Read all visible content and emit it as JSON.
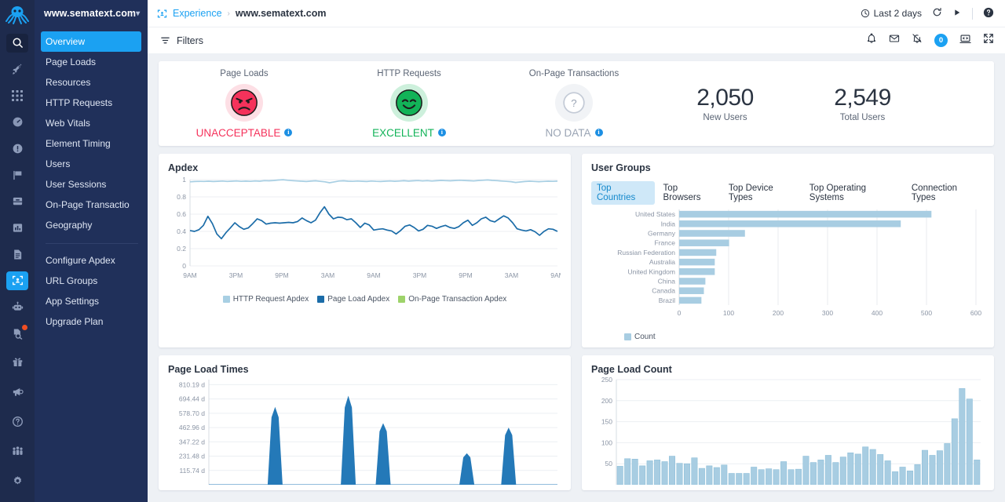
{
  "rail": {
    "logo": "octopus-logo",
    "items": [
      {
        "name": "search-icon"
      },
      {
        "name": "rocket-icon"
      },
      {
        "name": "grid-apps-icon"
      },
      {
        "name": "speedometer-icon"
      },
      {
        "name": "alert-circle-icon"
      },
      {
        "name": "flag-icon"
      },
      {
        "name": "archive-icon"
      },
      {
        "name": "bar-chart-icon"
      },
      {
        "name": "document-icon"
      },
      {
        "name": "experience-icon"
      },
      {
        "name": "robot-icon"
      },
      {
        "name": "document-search-icon"
      }
    ],
    "bottom_items": [
      {
        "name": "gift-icon"
      },
      {
        "name": "megaphone-icon"
      },
      {
        "name": "help-circle-icon"
      },
      {
        "name": "community-icon"
      },
      {
        "name": "gear-icon"
      }
    ]
  },
  "sidebar": {
    "app_name": "www.sematext.com",
    "caret": "⌄",
    "items": [
      {
        "label": "Overview",
        "active": true
      },
      {
        "label": "Page Loads",
        "active": false
      },
      {
        "label": "Resources",
        "active": false
      },
      {
        "label": "HTTP Requests",
        "active": false
      },
      {
        "label": "Web Vitals",
        "active": false
      },
      {
        "label": "Element Timing",
        "active": false
      },
      {
        "label": "Users",
        "active": false
      },
      {
        "label": "User Sessions",
        "active": false
      },
      {
        "label": "On-Page Transactio",
        "active": false
      },
      {
        "label": "Geography",
        "active": false
      }
    ],
    "secondary_items": [
      {
        "label": "Configure Apdex"
      },
      {
        "label": "URL Groups"
      },
      {
        "label": "App Settings"
      },
      {
        "label": "Upgrade Plan"
      }
    ]
  },
  "topbar": {
    "breadcrumb_icon": "experience-icon",
    "breadcrumb_parent": "Experience",
    "breadcrumb_sep": "›",
    "breadcrumb_current": "www.sematext.com",
    "time_range": "Last 2 days",
    "refresh_icon": "refresh-icon",
    "play_icon": "play-icon",
    "help_icon": "help-circle-icon"
  },
  "subbar": {
    "filters_label": "Filters",
    "filter_icon": "filter-icon",
    "icons": [
      {
        "name": "bell-add-icon"
      },
      {
        "name": "mail-icon"
      },
      {
        "name": "alerts-muted-icon"
      }
    ],
    "badge_count": "0",
    "terminal_icon": "terminal-icon",
    "fullscreen_icon": "fullscreen-icon"
  },
  "status_cards": [
    {
      "title": "Page Loads",
      "state": "UNACCEPTABLE",
      "face": "angry-face",
      "color": "#f5325b",
      "halo": "#fddfe5",
      "info_icon": "info-icon"
    },
    {
      "title": "HTTP Requests",
      "state": "EXCELLENT",
      "face": "happy-face",
      "color": "#12b358",
      "halo": "#cdf0dc",
      "info_icon": "info-icon"
    },
    {
      "title": "On-Page Transactions",
      "state": "NO DATA",
      "face": "question-face",
      "color": "#9aa4b4",
      "halo": "#f1f3f6",
      "info_icon": "info-icon"
    }
  ],
  "metrics": [
    {
      "value": "2,050",
      "caption": "New Users"
    },
    {
      "value": "2,549",
      "caption": "Total Users"
    }
  ],
  "panels": {
    "apdex_title": "Apdex",
    "user_groups_title": "User Groups",
    "page_load_times_title": "Page Load Times",
    "page_load_count_title": "Page Load Count"
  },
  "user_groups_tabs": [
    {
      "label": "Top Countries",
      "active": true
    },
    {
      "label": "Top Browsers",
      "active": false
    },
    {
      "label": "Top Device Types",
      "active": false
    },
    {
      "label": "Top Operating Systems",
      "active": false
    },
    {
      "label": "Connection Types",
      "active": false
    }
  ],
  "colors": {
    "accent": "#1ba1f2",
    "sidebar": "#20305a",
    "rail": "#1e2b4d",
    "light_blue": "#a8cfe3",
    "dark_blue": "#1b6ca8",
    "green": "#9ed36a",
    "bar_blue": "#2479b8",
    "count_bar": "#a8cde2"
  },
  "chart_data": [
    {
      "type": "line",
      "title": "Apdex",
      "xlabel": "",
      "ylabel": "",
      "ylim": [
        0,
        1
      ],
      "yticks": [
        "0",
        "0.2",
        "0.4",
        "0.6",
        "0.8",
        "1"
      ],
      "xticks": [
        "9AM",
        "3PM",
        "9PM",
        "3AM",
        "9AM",
        "3PM",
        "9PM",
        "3AM",
        "9AM"
      ],
      "grid": true,
      "legend_position": "bottom",
      "series": [
        {
          "name": "HTTP Request Apdex",
          "color": "#a8cfe3",
          "values": [
            0.975,
            0.978,
            0.98,
            0.979,
            0.982,
            0.978,
            0.981,
            0.984,
            0.979,
            0.982,
            0.985,
            0.98,
            0.983,
            0.98,
            0.985,
            0.982,
            0.988,
            0.986,
            0.99,
            0.995,
            0.999,
            0.993,
            0.988,
            0.985,
            0.982,
            0.978,
            0.983,
            0.986,
            0.98,
            0.975,
            0.964,
            0.974,
            0.984,
            0.986,
            0.982,
            0.98,
            0.984,
            0.981,
            0.978,
            0.984,
            0.98,
            0.978,
            0.982,
            0.985,
            0.981,
            0.984,
            0.987,
            0.983,
            0.986,
            0.989,
            0.985,
            0.988,
            0.984,
            0.987,
            0.991,
            0.988,
            0.986,
            0.99,
            0.993,
            0.99,
            0.987,
            0.985,
            0.99,
            0.993,
            0.996,
            0.991,
            0.988,
            0.984,
            0.98,
            0.976,
            0.967,
            0.973,
            0.978,
            0.982,
            0.979,
            0.976,
            0.979,
            0.982,
            0.98,
            0.983
          ]
        },
        {
          "name": "Page Load Apdex",
          "color": "#1b6ca8",
          "values": [
            0.41,
            0.4,
            0.42,
            0.47,
            0.575,
            0.49,
            0.37,
            0.315,
            0.385,
            0.44,
            0.5,
            0.455,
            0.425,
            0.44,
            0.49,
            0.545,
            0.525,
            0.485,
            0.495,
            0.5,
            0.495,
            0.5,
            0.505,
            0.5,
            0.515,
            0.555,
            0.525,
            0.5,
            0.53,
            0.615,
            0.685,
            0.6,
            0.545,
            0.565,
            0.56,
            0.535,
            0.545,
            0.5,
            0.445,
            0.495,
            0.475,
            0.415,
            0.425,
            0.43,
            0.415,
            0.405,
            0.37,
            0.41,
            0.46,
            0.475,
            0.445,
            0.405,
            0.425,
            0.47,
            0.46,
            0.435,
            0.455,
            0.47,
            0.445,
            0.435,
            0.455,
            0.5,
            0.53,
            0.47,
            0.5,
            0.545,
            0.565,
            0.525,
            0.51,
            0.545,
            0.58,
            0.555,
            0.5,
            0.43,
            0.415,
            0.405,
            0.42,
            0.395,
            0.355,
            0.4,
            0.43,
            0.425,
            0.4
          ]
        },
        {
          "name": "On-Page Transaction Apdex",
          "color": "#9ed36a",
          "values": []
        }
      ]
    },
    {
      "type": "bar",
      "orientation": "horizontal",
      "title": "User Groups - Top Countries",
      "xlabel": "",
      "ylabel": "",
      "xlim": [
        0,
        600
      ],
      "xticks": [
        0,
        100,
        200,
        300,
        400,
        500,
        600
      ],
      "grid": true,
      "legend_position": "bottom-left",
      "legend_entries": [
        "Count"
      ],
      "series_color": "#a8cde2",
      "categories": [
        "United States",
        "India",
        "Germany",
        "France",
        "Russian Federation",
        "Australia",
        "United Kingdom",
        "China",
        "Canada",
        "Brazil"
      ],
      "values": [
        510,
        448,
        133,
        101,
        75,
        72,
        72,
        53,
        50,
        45
      ]
    },
    {
      "type": "area",
      "title": "Page Load Times",
      "xlabel": "",
      "ylabel": "",
      "yticks": [
        "810.19 d",
        "694.44 d",
        "578.70 d",
        "462.96 d",
        "347.22 d",
        "231.48 d",
        "115.74 d"
      ],
      "ytick_values": [
        810.19,
        694.44,
        578.7,
        462.96,
        347.22,
        231.48,
        115.74
      ],
      "grid": true,
      "series_color": "#2479b8",
      "peaks": [
        {
          "x_frac": 0.19,
          "value": 620
        },
        {
          "x_frac": 0.4,
          "value": 710
        },
        {
          "x_frac": 0.5,
          "value": 490
        },
        {
          "x_frac": 0.74,
          "value": 250
        },
        {
          "x_frac": 0.86,
          "value": 455
        }
      ]
    },
    {
      "type": "bar",
      "title": "Page Load Count",
      "xlabel": "",
      "ylabel": "",
      "ylim": [
        0,
        250
      ],
      "yticks": [
        50,
        100,
        150,
        200,
        250
      ],
      "grid": true,
      "series_color": "#a8cde2",
      "values": [
        44,
        62,
        61,
        45,
        57,
        59,
        55,
        68,
        51,
        50,
        64,
        39,
        45,
        41,
        47,
        27,
        27,
        27,
        42,
        36,
        38,
        36,
        55,
        36,
        37,
        68,
        53,
        59,
        70,
        53,
        66,
        76,
        73,
        90,
        84,
        72,
        57,
        31,
        42,
        33,
        48,
        82,
        70,
        81,
        98,
        157,
        229,
        204,
        59
      ]
    }
  ]
}
